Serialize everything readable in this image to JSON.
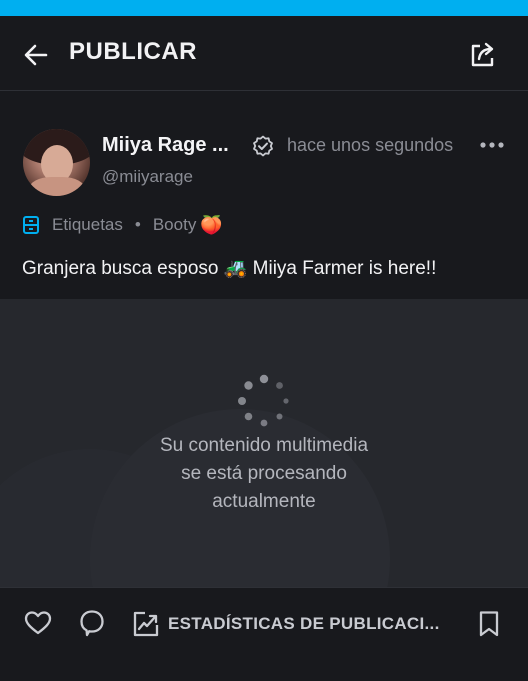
{
  "header": {
    "title": "PUBLICAR",
    "back_icon": "arrow-left-icon",
    "share_icon": "share-icon"
  },
  "post": {
    "display_name": "Miiya Rage ...",
    "username": "@miiyarage",
    "timestamp": "hace unos segundos",
    "tags_label": "Etiquetas",
    "tag": "Booty",
    "tag_emoji": "🍑",
    "caption": "Granjera busca esposo 🚜 Miiya Farmer is here!!"
  },
  "media": {
    "processing_line1": "Su contenido multimedia",
    "processing_line2": "se está procesando",
    "processing_line3": "actualmente"
  },
  "footer": {
    "stats_label": "ESTADÍSTICAS DE PUBLICACI..."
  },
  "colors": {
    "accent": "#00aff0",
    "background": "#18191d",
    "media_background": "#26282d",
    "muted_text": "#8a8c94"
  }
}
